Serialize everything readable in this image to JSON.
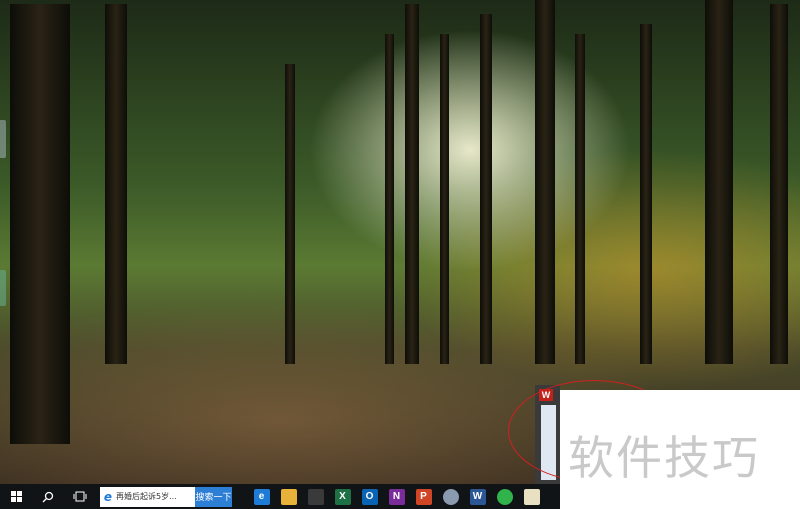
{
  "taskbar": {
    "start_icon": "windows-logo-icon",
    "search_icon": "search-icon",
    "task_view_icon": "task-view-icon",
    "browser_search": {
      "text": "再婚后起诉5岁...",
      "button": "搜索一下"
    },
    "apps": [
      {
        "name": "edge-icon",
        "glyph": "e",
        "color": "#1e7bd6"
      },
      {
        "name": "file-explorer-icon",
        "glyph": "",
        "color": "#e8b23a"
      },
      {
        "name": "store-icon",
        "glyph": "",
        "color": "#3a3a3a"
      },
      {
        "name": "excel-icon",
        "glyph": "X",
        "color": "#1e7145"
      },
      {
        "name": "outlook-icon",
        "glyph": "O",
        "color": "#0a64b4"
      },
      {
        "name": "onenote-icon",
        "glyph": "N",
        "color": "#7b2c9b"
      },
      {
        "name": "powerpoint-icon",
        "glyph": "P",
        "color": "#d04525"
      },
      {
        "name": "paint-icon",
        "glyph": "",
        "color": "#8a9bb0"
      },
      {
        "name": "word-icon",
        "glyph": "W",
        "color": "#2b5797"
      },
      {
        "name": "green-app-icon",
        "glyph": "",
        "color": "#2fb34a"
      },
      {
        "name": "notepad-icon",
        "glyph": "",
        "color": "#e8e0c0"
      }
    ]
  },
  "thumbnail": {
    "logo_letter": "W"
  },
  "watermark": {
    "text": "软件技巧"
  }
}
